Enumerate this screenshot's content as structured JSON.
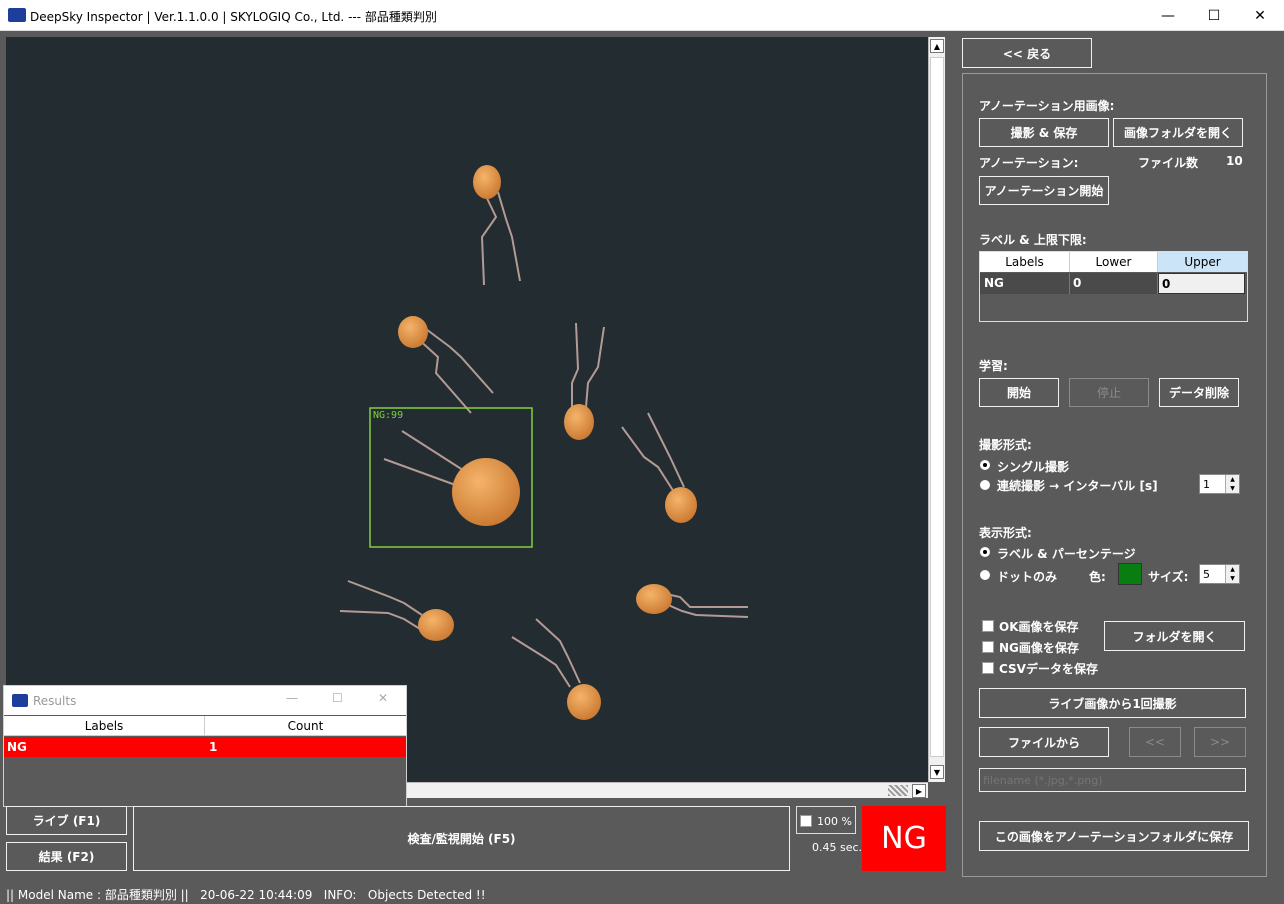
{
  "window": {
    "title": "DeepSky Inspector | Ver.1.1.0.0 | SKYLOGIQ Co., Ltd. --- 部品種類判別",
    "minimize": "—",
    "maximize": "☐",
    "close": "✕"
  },
  "viewer": {
    "detection_label": "NG:99",
    "box_color": "#7fd03a"
  },
  "results_window": {
    "title": "Results",
    "columns": [
      "Labels",
      "Count"
    ],
    "rows": [
      {
        "label": "NG",
        "count": "1"
      }
    ]
  },
  "bottom": {
    "live_button": "ライブ (F1)",
    "result_button": "結果 (F2)",
    "start_button": "検査/監視開始 (F5)",
    "zoom_label": "100 %",
    "time_label": "0.45 sec.",
    "verdict": "NG",
    "verdict_color": "#ff0000"
  },
  "sidebar": {
    "back_button": "<< 戻る",
    "annotation_images_label": "アノーテーション用画像:",
    "capture_save_button": "撮影 & 保存",
    "open_image_folder_button": "画像フォルダを開く",
    "annotation_label": "アノーテーション:",
    "file_count_label": "ファイル数",
    "file_count_value": "10",
    "annotation_start_button": "アノーテーション開始",
    "label_limits_label": "ラベル & 上限下限:",
    "table": {
      "headers": [
        "Labels",
        "Lower",
        "Upper"
      ],
      "row": {
        "label": "NG",
        "lower": "0",
        "upper": "0"
      }
    },
    "training_label": "学習:",
    "train_start_button": "開始",
    "train_stop_button": "停止",
    "delete_data_button": "データ削除",
    "capture_mode_label": "撮影形式:",
    "single_capture_option": "シングル撮影",
    "continuous_capture_option": "連続撮影 → インターバル [s]",
    "interval_value": "1",
    "display_mode_label": "表示形式:",
    "label_percentage_option": "ラベル & パーセンテージ",
    "dot_only_option": "ドットのみ",
    "color_label": "色:",
    "dot_color": "#0a7d12",
    "size_label": "サイズ:",
    "size_value": "5",
    "save_ok_checkbox": "OK画像を保存",
    "save_ng_checkbox": "NG画像を保存",
    "save_csv_checkbox": "CSVデータを保存",
    "open_folder_button": "フォルダを開く",
    "capture_once_button": "ライブ画像から1回撮影",
    "from_file_button": "ファイルから",
    "prev_button": "<<",
    "next_button": ">>",
    "filename_placeholder": "filename (*.jpg,*.png)",
    "save_to_annotation_button": "この画像をアノーテーションフォルダに保存"
  },
  "status": {
    "text": "|| Model Name : 部品種類判別 ||   20-06-22 10:44:09   INFO:   Objects Detected !!"
  }
}
